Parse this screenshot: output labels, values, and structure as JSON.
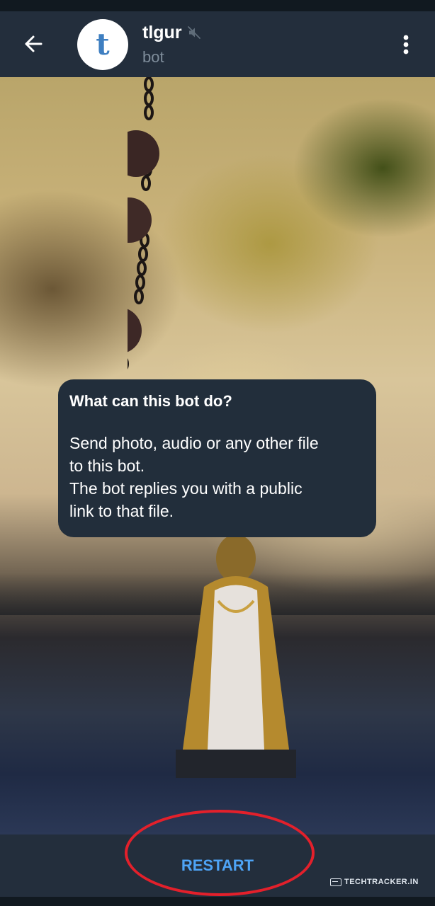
{
  "header": {
    "title": "tlgur",
    "subtitle": "bot",
    "avatar_letter": "t",
    "back_icon": "arrow-left-icon",
    "mute_icon": "speaker-muted-icon",
    "menu_icon": "more-vertical-icon"
  },
  "info_bubble": {
    "title": "What can this bot do?",
    "lines": [
      "Send photo, audio or any other file",
      "to this bot.",
      "The bot replies you with a public",
      "link to that file."
    ]
  },
  "bottom_bar": {
    "restart_label": "RESTART"
  },
  "watermark": {
    "text": "TECHTRACKER.IN"
  },
  "colors": {
    "header_bg": "#232e3c",
    "bubble_bg": "#222e3b",
    "accent_blue": "#4ea4f6",
    "annotation_red": "#e3202b",
    "avatar_letter": "#3f7fc1"
  }
}
